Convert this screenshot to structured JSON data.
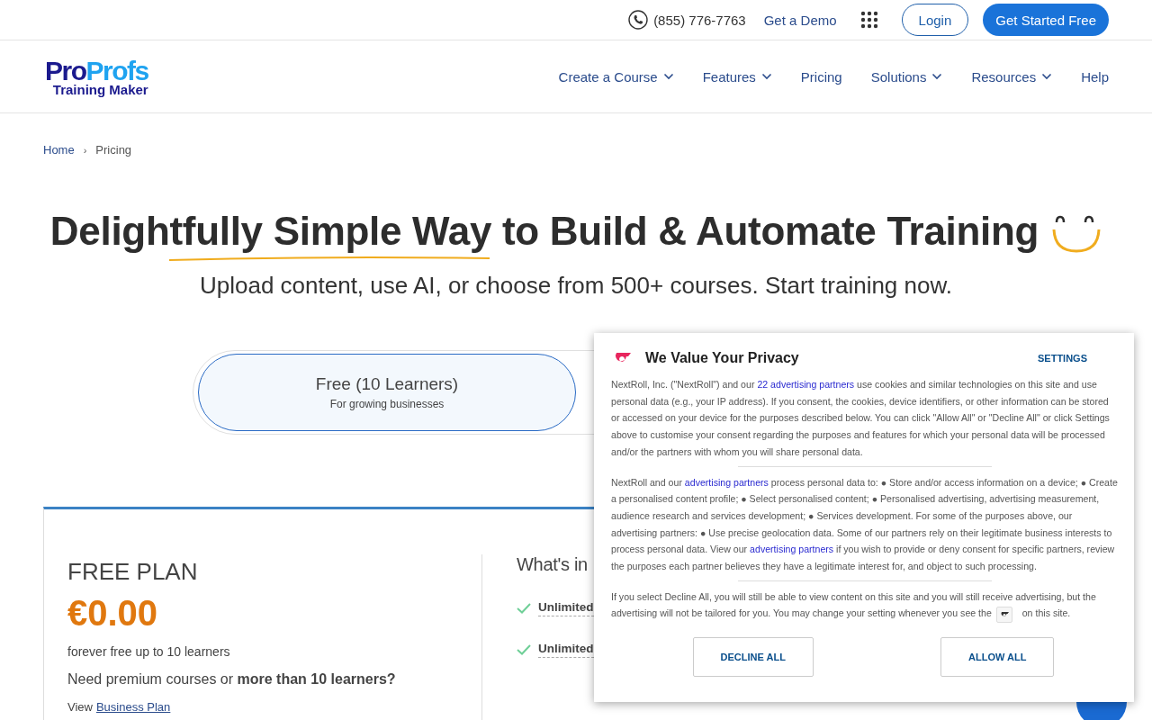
{
  "top_bar": {
    "phone": "(855) 776-7763",
    "demo_link": "Get a Demo",
    "login_button": "Login",
    "cta_button": "Get Started Free"
  },
  "logo": {
    "brand_dark": "Pro",
    "brand_light": "Profs",
    "product": "Training Maker"
  },
  "nav": [
    {
      "label": "Create a Course",
      "has_menu": true
    },
    {
      "label": "Features",
      "has_menu": true
    },
    {
      "label": "Pricing",
      "has_menu": false
    },
    {
      "label": "Solutions",
      "has_menu": true
    },
    {
      "label": "Resources",
      "has_menu": true
    },
    {
      "label": "Help",
      "has_menu": false
    }
  ],
  "breadcrumb": [
    "Home",
    "Pricing"
  ],
  "breadcrumb_separator": "›",
  "hero": {
    "title": "Delightfully Simple Way to Build & Automate Training",
    "subtitle": "Upload content, use AI, or choose from 500+ courses. Start training now."
  },
  "plan_toggle": [
    {
      "title": "Free (10 Learners)",
      "caption": "For growing businesses",
      "selected": true
    }
  ],
  "plan_card": {
    "name": "FREE PLAN",
    "price": "€0.00",
    "note": "forever free up to 10 learners",
    "upsell": "Need premium courses or **more than 10 learners?**",
    "view_prefix": "View",
    "view_link": "Business Plan",
    "features_heading": "What's in",
    "features": [
      "Unlimited",
      "Unlimited"
    ]
  },
  "consent": {
    "title": "We Value Your Privacy",
    "settings": "SETTINGS",
    "paragraphs": [
      [
        {
          "kind": "text",
          "text": "NextRoll, Inc. (\"NextRoll\") and our "
        },
        {
          "kind": "link",
          "text": "22 advertising partners"
        },
        {
          "kind": "text",
          "text": " use cookies and similar technologies on this site and use personal data (e.g., your IP address). If you consent, the cookies, device identifiers, or other information can be stored or accessed on your device for the purposes described below. You can click \"Allow All\" or \"Decline All\" or click Settings above to customise your consent regarding the purposes and features for which your personal data will be processed and/or the partners with whom you will share personal data."
        }
      ],
      [
        {
          "kind": "text",
          "text": "NextRoll and our "
        },
        {
          "kind": "link",
          "text": "advertising partners"
        },
        {
          "kind": "text",
          "text": " process personal data to: ● Store and/or access information on a device; ● Create a personalised content profile; ● Select personalised content; ● Personalised advertising, advertising measurement, audience research and services development; ● Services development. For some of the purposes above, our advertising partners: ● Use precise geolocation data. Some of our partners rely on their legitimate business interests to process personal data. View our "
        },
        {
          "kind": "link",
          "text": "advertising partners"
        },
        {
          "kind": "text",
          "text": " if you wish to provide or deny consent for specific partners, review the purposes each partner believes they have a legitimate interest for, and object to such processing."
        }
      ],
      [
        {
          "kind": "text",
          "text": "If you select Decline All, you will still be able to view content on this site and you will still receive advertising, but the advertising will not be tailored for you. You may change your setting whenever you see the "
        },
        {
          "kind": "icon"
        },
        {
          "kind": "text",
          "text": " on this site."
        }
      ]
    ],
    "buttons": [
      "DECLINE ALL",
      "ALLOW ALL"
    ]
  }
}
